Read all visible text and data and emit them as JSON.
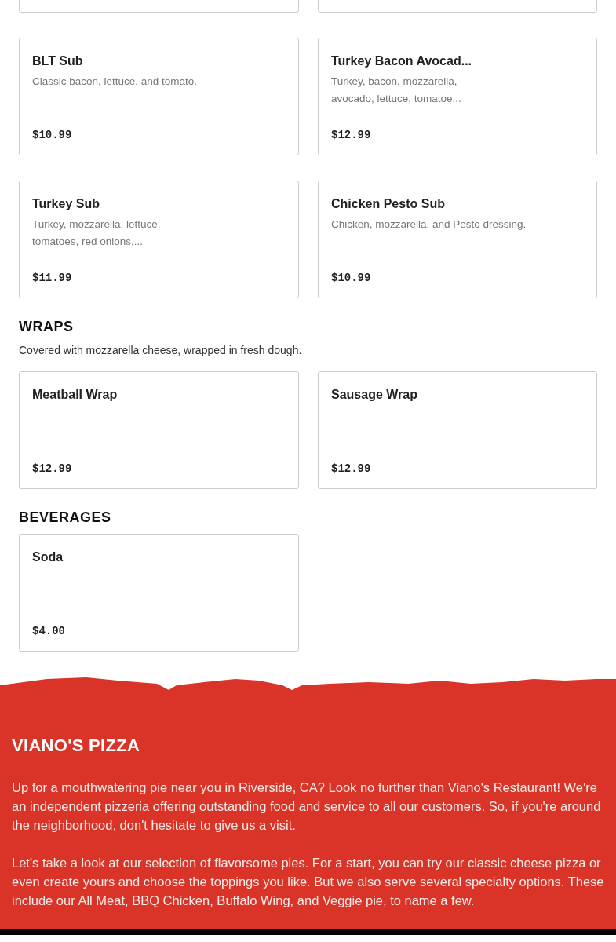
{
  "menu_sections": [
    {
      "items": [
        {
          "name": "BLT Sub",
          "description": "Classic bacon, lettuce, and tomato.",
          "price": "$10.99"
        },
        {
          "name": "Turkey Bacon Avocad...",
          "description": "Turkey, bacon, mozzarella,\navocado, lettuce, tomatoe...",
          "price": "$12.99"
        },
        {
          "name": "Turkey Sub",
          "description": "Turkey, mozzarella, lettuce,\ntomatoes, red onions,...",
          "price": "$11.99"
        },
        {
          "name": "Chicken Pesto Sub",
          "description": "Chicken, mozzarella, and Pesto dressing.",
          "price": "$10.99"
        }
      ]
    },
    {
      "title": "WRAPS",
      "description": "Covered with mozzarella cheese, wrapped in fresh dough.",
      "items": [
        {
          "name": "Meatball Wrap",
          "price": "$12.99"
        },
        {
          "name": "Sausage Wrap",
          "price": "$12.99"
        }
      ]
    },
    {
      "title": "BEVERAGES",
      "items": [
        {
          "name": "Soda",
          "price": "$4.00"
        }
      ]
    }
  ],
  "footer": {
    "title": "VIANO'S PIZZA",
    "paragraphs": [
      "Up for a mouthwatering pie near you in Riverside, CA? Look no further than Viano's Restaurant! We're an independent pizzeria offering outstanding food and service to all our customers. So, if you're around the neighborhood, don't hesitate to give us a visit.",
      "Let's take a look at our selection of flavorsome pies. For a start, you can try our classic cheese pizza or even create yours and choose the toppings you like. But we also serve several specialty options. These include our All Meat, BBQ Chicken, Buffalo Wing, and Veggie pie, to name a few."
    ]
  }
}
